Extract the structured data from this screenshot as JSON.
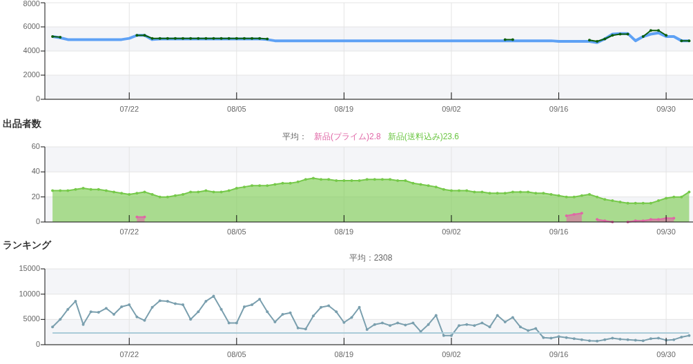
{
  "price_chart": {
    "chart_data": {
      "type": "line",
      "grid": true,
      "ylim": [
        0,
        8000
      ],
      "yticks": [
        0,
        2000,
        4000,
        6000,
        8000
      ],
      "categories": [
        null,
        null,
        null,
        null,
        null,
        null,
        null,
        null,
        null,
        null,
        "07/22",
        null,
        null,
        null,
        null,
        null,
        null,
        null,
        null,
        null,
        null,
        null,
        null,
        null,
        "08/05",
        null,
        null,
        null,
        null,
        null,
        null,
        null,
        null,
        null,
        null,
        null,
        null,
        null,
        "08/19",
        null,
        null,
        null,
        null,
        null,
        null,
        null,
        null,
        null,
        null,
        null,
        null,
        null,
        "09/02",
        null,
        null,
        null,
        null,
        null,
        null,
        null,
        null,
        null,
        null,
        null,
        null,
        null,
        "09/16",
        null,
        null,
        null,
        null,
        null,
        null,
        null,
        null,
        null,
        null,
        null,
        null,
        null,
        "09/30",
        null,
        null,
        null
      ],
      "series": [
        {
          "color": "#5ea1f5",
          "values": [
            5200,
            5100,
            4950,
            4950,
            4950,
            4950,
            4950,
            4950,
            4950,
            4950,
            5050,
            5300,
            5300,
            4950,
            5000,
            5000,
            5000,
            5000,
            5000,
            5000,
            5000,
            5000,
            5000,
            5000,
            5000,
            5000,
            5000,
            5000,
            4950,
            4850,
            4850,
            4850,
            4850,
            4850,
            4850,
            4850,
            4850,
            4850,
            4850,
            4850,
            4850,
            4850,
            4850,
            4850,
            4850,
            4850,
            4850,
            4850,
            4850,
            4850,
            4850,
            4850,
            4850,
            4850,
            4850,
            4850,
            4850,
            4850,
            4850,
            4850,
            4850,
            4850,
            4850,
            4850,
            4850,
            4850,
            4800,
            4800,
            4800,
            4800,
            4800,
            4700,
            5000,
            5400,
            5450,
            5450,
            4850,
            5200,
            5400,
            5500,
            5200,
            5200,
            4850,
            4850
          ]
        },
        {
          "color": "#0b5e0b",
          "values": [
            5200,
            5150,
            null,
            null,
            null,
            null,
            null,
            null,
            null,
            null,
            null,
            5300,
            5300,
            5050,
            5050,
            5050,
            5050,
            5050,
            5050,
            5050,
            5050,
            5050,
            5050,
            5050,
            5050,
            5050,
            5050,
            5050,
            5000,
            null,
            null,
            null,
            null,
            null,
            null,
            null,
            null,
            null,
            null,
            null,
            null,
            null,
            null,
            null,
            null,
            null,
            null,
            null,
            null,
            null,
            null,
            null,
            null,
            null,
            null,
            null,
            null,
            null,
            null,
            4950,
            4950,
            null,
            null,
            null,
            null,
            null,
            null,
            null,
            null,
            null,
            4900,
            4800,
            5000,
            5300,
            5400,
            5400,
            null,
            5200,
            5700,
            5700,
            5300,
            null,
            4850,
            4850
          ]
        }
      ]
    }
  },
  "sellers": {
    "title": "出品者数",
    "average": {
      "label": "平均：",
      "items": [
        {
          "text": "新品(プライム)2.8",
          "color": "#e066a6"
        },
        {
          "text": "新品(送料込み)23.6",
          "color": "#6cc644"
        }
      ]
    },
    "chart_data": {
      "type": "area",
      "grid": true,
      "ylim": [
        0,
        60
      ],
      "yticks": [
        0,
        20,
        40,
        60
      ],
      "categories": [
        null,
        null,
        null,
        null,
        null,
        null,
        null,
        null,
        null,
        null,
        "07/22",
        null,
        null,
        null,
        null,
        null,
        null,
        null,
        null,
        null,
        null,
        null,
        null,
        null,
        "08/05",
        null,
        null,
        null,
        null,
        null,
        null,
        null,
        null,
        null,
        null,
        null,
        null,
        null,
        "08/19",
        null,
        null,
        null,
        null,
        null,
        null,
        null,
        null,
        null,
        null,
        null,
        null,
        null,
        "09/02",
        null,
        null,
        null,
        null,
        null,
        null,
        null,
        null,
        null,
        null,
        null,
        null,
        null,
        "09/16",
        null,
        null,
        null,
        null,
        null,
        null,
        null,
        null,
        null,
        null,
        null,
        null,
        null,
        "09/30",
        null,
        null,
        null
      ],
      "series": [
        {
          "color": "#76c94a",
          "values": [
            25,
            25,
            25,
            26,
            27,
            26,
            26,
            25,
            24,
            23,
            22,
            23,
            24,
            22,
            20,
            20,
            21,
            22,
            24,
            24,
            25,
            24,
            24,
            25,
            27,
            28,
            29,
            29,
            29,
            30,
            31,
            31,
            32,
            34,
            35,
            34,
            34,
            33,
            33,
            33,
            33,
            34,
            34,
            34,
            34,
            33,
            33,
            31,
            30,
            29,
            28,
            26,
            25,
            25,
            25,
            24,
            24,
            23,
            23,
            23,
            24,
            24,
            24,
            23,
            23,
            22,
            21,
            20,
            20,
            21,
            22,
            20,
            18,
            17,
            16,
            15,
            15,
            15,
            15,
            17,
            19,
            20,
            20,
            24
          ]
        },
        {
          "color": "#e066a6",
          "values": [
            null,
            null,
            null,
            null,
            null,
            null,
            null,
            null,
            null,
            null,
            null,
            4,
            4,
            null,
            null,
            null,
            null,
            null,
            null,
            null,
            null,
            null,
            null,
            null,
            null,
            null,
            null,
            null,
            null,
            null,
            null,
            null,
            null,
            null,
            null,
            null,
            null,
            null,
            null,
            null,
            null,
            null,
            null,
            null,
            null,
            null,
            null,
            null,
            null,
            null,
            null,
            null,
            null,
            null,
            null,
            null,
            null,
            null,
            null,
            null,
            null,
            null,
            null,
            null,
            null,
            null,
            null,
            5,
            6,
            7,
            null,
            2,
            1,
            0,
            null,
            0,
            1,
            1,
            2,
            2,
            3,
            3,
            null,
            null
          ]
        }
      ]
    }
  },
  "ranking": {
    "title": "ランキング",
    "average": "平均：2308",
    "chart_data": {
      "type": "line",
      "grid": true,
      "ylim": [
        0,
        15000
      ],
      "yticks": [
        0,
        5000,
        10000,
        15000
      ],
      "categories": [
        null,
        null,
        null,
        null,
        null,
        null,
        null,
        null,
        null,
        null,
        "07/22",
        null,
        null,
        null,
        null,
        null,
        null,
        null,
        null,
        null,
        null,
        null,
        null,
        null,
        "08/05",
        null,
        null,
        null,
        null,
        null,
        null,
        null,
        null,
        null,
        null,
        null,
        null,
        null,
        "08/19",
        null,
        null,
        null,
        null,
        null,
        null,
        null,
        null,
        null,
        null,
        null,
        null,
        null,
        "09/02",
        null,
        null,
        null,
        null,
        null,
        null,
        null,
        null,
        null,
        null,
        null,
        null,
        null,
        "09/16",
        null,
        null,
        null,
        null,
        null,
        null,
        null,
        null,
        null,
        null,
        null,
        null,
        null,
        "09/30",
        null,
        null,
        null
      ],
      "series": [
        {
          "color": "#7a9fae",
          "values": [
            3500,
            5000,
            7000,
            8600,
            4000,
            6500,
            6400,
            7200,
            6000,
            7500,
            7900,
            5500,
            4800,
            7400,
            8700,
            8600,
            8100,
            7900,
            5000,
            6500,
            8600,
            9600,
            7000,
            4300,
            4300,
            7500,
            7900,
            9000,
            6500,
            4500,
            6000,
            6300,
            3300,
            3100,
            5700,
            7400,
            7700,
            6500,
            4400,
            5400,
            7400,
            3000,
            4000,
            4300,
            3800,
            4300,
            3900,
            4300,
            2600,
            4000,
            5800,
            1800,
            1800,
            3800,
            4000,
            3800,
            4300,
            3500,
            5800,
            4500,
            5400,
            3500,
            2800,
            3200,
            1400,
            1300,
            1600,
            1400,
            1200,
            1000,
            800,
            700,
            1000,
            1300,
            1100,
            1000,
            900,
            800,
            1200,
            1300,
            900,
            1000,
            1500,
            1800
          ]
        },
        {
          "color": "#a9cbd8",
          "values": [
            2308,
            2308,
            2308,
            2308,
            2308,
            2308,
            2308,
            2308,
            2308,
            2308,
            2308,
            2308,
            2308,
            2308,
            2308,
            2308,
            2308,
            2308,
            2308,
            2308,
            2308,
            2308,
            2308,
            2308,
            2308,
            2308,
            2308,
            2308,
            2308,
            2308,
            2308,
            2308,
            2308,
            2308,
            2308,
            2308,
            2308,
            2308,
            2308,
            2308,
            2308,
            2308,
            2308,
            2308,
            2308,
            2308,
            2308,
            2308,
            2308,
            2308,
            2308,
            2308,
            2308,
            2308,
            2308,
            2308,
            2308,
            2308,
            2308,
            2308,
            2308,
            2308,
            2308,
            2308,
            2308,
            2308,
            2308,
            2308,
            2308,
            2308,
            2308,
            2308,
            2308,
            2308,
            2308,
            2308,
            2308,
            2308,
            2308,
            2308,
            2308,
            2308,
            2308,
            2308
          ]
        }
      ]
    }
  }
}
